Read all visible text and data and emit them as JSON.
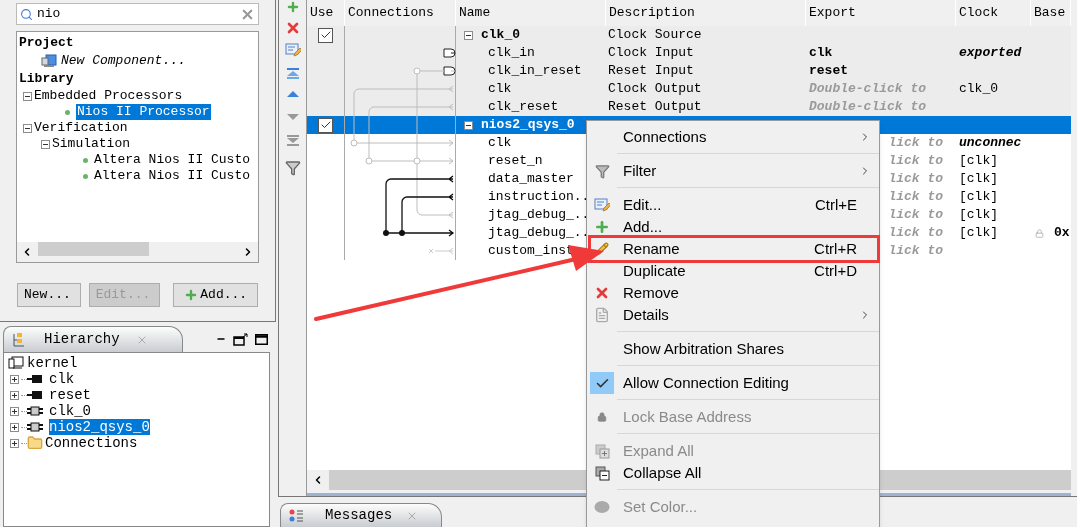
{
  "search": {
    "value": "nio"
  },
  "catalog": {
    "tree": [
      {
        "label": "Project",
        "kind": "heading",
        "children": [
          {
            "label": "New Component...",
            "kind": "new",
            "selected": false
          }
        ]
      },
      {
        "label": "Library",
        "kind": "heading",
        "children": [
          {
            "label": "Embedded Processors",
            "kind": "group",
            "expanded": true,
            "selected": false,
            "children": [
              {
                "label": "Nios II Processor",
                "kind": "leaf",
                "selected": true
              }
            ]
          },
          {
            "label": "Verification",
            "kind": "group",
            "expanded": true,
            "selected": false,
            "children": [
              {
                "label": "Simulation",
                "kind": "group",
                "expanded": true,
                "selected": false,
                "children": [
                  {
                    "label": "Altera Nios II Custo",
                    "kind": "leaf",
                    "selected": false
                  },
                  {
                    "label": "Altera Nios II Custo",
                    "kind": "leaf",
                    "selected": false
                  }
                ]
              }
            ]
          }
        ]
      }
    ],
    "buttons": [
      {
        "label": "New...",
        "kind": "plain",
        "disabled": false
      },
      {
        "label": "Edit...",
        "kind": "plain",
        "disabled": true
      },
      {
        "label": "Add...",
        "kind": "add",
        "disabled": false
      }
    ]
  },
  "hierarchy": {
    "title": "Hierarchy",
    "root": {
      "label": "kernel",
      "children": [
        {
          "label": "clk",
          "kind": "port",
          "expanded": false,
          "selected": false
        },
        {
          "label": "reset",
          "kind": "port",
          "expanded": false,
          "selected": false
        },
        {
          "label": "clk_0",
          "kind": "component",
          "expanded": false,
          "selected": false
        },
        {
          "label": "nios2_qsys_0",
          "kind": "component",
          "expanded": false,
          "selected": true
        },
        {
          "label": "Connections",
          "kind": "folder",
          "expanded": false,
          "selected": false
        }
      ]
    }
  },
  "table": {
    "columns": [
      "Use",
      "Connections",
      "Name",
      "Description",
      "Export",
      "Clock",
      "Base"
    ],
    "rows": [
      {
        "kind": "group",
        "checked": true,
        "expanded": true,
        "selected": false,
        "shaded": true,
        "name": "clk_0",
        "description": "Clock Source"
      },
      {
        "kind": "port",
        "selected": false,
        "shaded": true,
        "name": "clk_in",
        "description": "Clock Input",
        "export": {
          "text": "clk",
          "kind": "bold"
        },
        "clock": {
          "text": "exported",
          "kind": "bold_italic"
        }
      },
      {
        "kind": "port",
        "selected": false,
        "shaded": true,
        "name": "clk_in_reset",
        "description": "Reset Input",
        "export": {
          "text": "reset",
          "kind": "bold"
        }
      },
      {
        "kind": "port",
        "selected": false,
        "shaded": true,
        "name": "clk",
        "description": "Clock Output",
        "export": {
          "text": "Double-click to",
          "kind": "hint"
        },
        "clock": {
          "text": "clk_0",
          "kind": "plain"
        }
      },
      {
        "kind": "port",
        "selected": false,
        "shaded": true,
        "name": "clk_reset",
        "description": "Reset Output",
        "export": {
          "text": "Double-click to",
          "kind": "hint"
        }
      },
      {
        "kind": "group",
        "checked": true,
        "expanded": true,
        "selected": true,
        "name": "nios2_qsys_0"
      },
      {
        "kind": "port",
        "selected": false,
        "shaded": false,
        "name": "clk",
        "export": {
          "text": "lick to",
          "kind": "hint_cut"
        },
        "clock": {
          "text": "unconnec",
          "kind": "bold_italic"
        }
      },
      {
        "kind": "port",
        "selected": false,
        "shaded": false,
        "name": "reset_n",
        "export": {
          "text": "lick to",
          "kind": "hint_cut"
        },
        "clock": {
          "text": "[clk]",
          "kind": "plain"
        }
      },
      {
        "kind": "port",
        "selected": false,
        "shaded": false,
        "name": "data_master",
        "export": {
          "text": "lick to",
          "kind": "hint_cut"
        },
        "clock": {
          "text": "[clk]",
          "kind": "plain"
        }
      },
      {
        "kind": "port",
        "selected": false,
        "shaded": false,
        "name": "instruction..",
        "export": {
          "text": "lick to",
          "kind": "hint_cut"
        },
        "clock": {
          "text": "[clk]",
          "kind": "plain"
        }
      },
      {
        "kind": "port",
        "selected": false,
        "shaded": false,
        "name": "jtag_debug_..",
        "export": {
          "text": "lick to",
          "kind": "hint_cut"
        },
        "clock": {
          "text": "[clk]",
          "kind": "plain"
        }
      },
      {
        "kind": "port",
        "selected": false,
        "shaded": false,
        "name": "jtag_debug_..",
        "export": {
          "text": "lick to",
          "kind": "hint_cut"
        },
        "clock": {
          "text": "[clk]",
          "kind": "plain"
        },
        "base": {
          "text": "0x",
          "locked": true
        }
      },
      {
        "kind": "port",
        "selected": false,
        "shaded": false,
        "name": "custom_inst",
        "export": {
          "text": "lick to",
          "kind": "hint_cut"
        }
      }
    ]
  },
  "menu": {
    "groups": [
      [
        {
          "label": "Connections",
          "kind": "plain",
          "submenu": true,
          "disabled": false,
          "checked": false
        }
      ],
      [
        {
          "label": "Filter",
          "kind": "filter",
          "submenu": true,
          "disabled": false,
          "checked": false
        }
      ],
      [
        {
          "label": "Edit...",
          "shortcut": "Ctrl+E",
          "kind": "edit",
          "submenu": false,
          "disabled": false,
          "checked": false
        },
        {
          "label": "Add...",
          "kind": "add",
          "submenu": false,
          "disabled": false,
          "checked": false
        },
        {
          "label": "Rename",
          "shortcut": "Ctrl+R",
          "kind": "rename",
          "submenu": false,
          "disabled": false,
          "checked": false
        },
        {
          "label": "Duplicate",
          "shortcut": "Ctrl+D",
          "kind": "plain",
          "submenu": false,
          "disabled": false,
          "checked": false
        },
        {
          "label": "Remove",
          "kind": "remove",
          "submenu": false,
          "disabled": false,
          "checked": false
        },
        {
          "label": "Details",
          "kind": "details",
          "submenu": true,
          "disabled": false,
          "checked": false
        }
      ],
      [
        {
          "label": "Show Arbitration Shares",
          "kind": "plain",
          "submenu": false,
          "disabled": false,
          "checked": false
        }
      ],
      [
        {
          "label": "Allow Connection Editing",
          "submenu": false,
          "disabled": false,
          "checked": true
        }
      ],
      [
        {
          "label": "Lock Base Address",
          "kind": "lock",
          "submenu": false,
          "disabled": true,
          "checked": false
        }
      ],
      [
        {
          "label": "Expand All",
          "kind": "expand",
          "submenu": false,
          "disabled": true,
          "checked": false
        },
        {
          "label": "Collapse All",
          "kind": "collapse",
          "submenu": false,
          "disabled": false,
          "checked": false
        }
      ],
      [
        {
          "label": "Set Color...",
          "kind": "color",
          "submenu": false,
          "disabled": true,
          "checked": false
        }
      ]
    ]
  },
  "messages_tab": {
    "title": "Messages"
  }
}
